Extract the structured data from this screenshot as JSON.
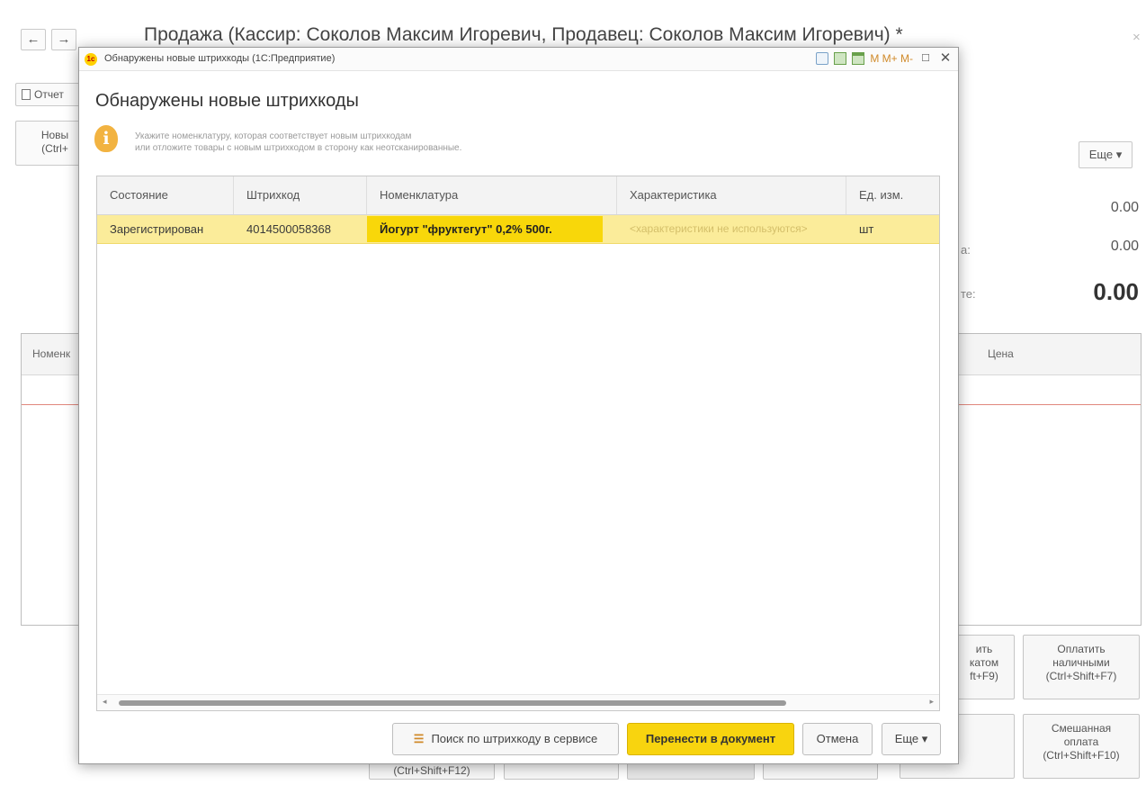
{
  "background": {
    "title": "Продажа (Кассир: Соколов Максим Игоревич, Продавец: Соколов Максим Игоревич) *",
    "back_icon": "arrow-left-icon",
    "forward_icon": "arrow-right-icon",
    "report_button": "Отчет",
    "new_button_line1": "Новы",
    "new_button_line2": "(Ctrl+",
    "more_button": "Еще ▾",
    "amount1": "0.00",
    "amount2": "0.00",
    "amount_total": "0.00",
    "label_partial1": "а:",
    "label_partial2": "те:",
    "table": {
      "col_nomenclature": "Номенк",
      "col_price": "Цена"
    },
    "buttons": {
      "pay_card_line1": "ить",
      "pay_card_line2": "катом",
      "pay_card_line3": "ft+F9)",
      "pay_cash_line1": "Оплатить",
      "pay_cash_line2": "наличными",
      "pay_cash_line3": "(Ctrl+Shift+F7)",
      "mixed_line1": "Смешанная",
      "mixed_line2": "оплата",
      "mixed_line3": "(Ctrl+Shift+F10)",
      "partial_f12": "(Ctrl+Shift+F12)"
    }
  },
  "dialog": {
    "window_title": "Обнаружены новые штрихкоды  (1С:Предприятие)",
    "heading": "Обнаружены новые штрихкоды",
    "info_line1": "Укажите номенклатуру, которая соответствует новым штрихкодам",
    "info_line2": "или отложите товары с новым штрихкодом в сторону как неотсканированные.",
    "titlebar_memory": "M  M+  M-",
    "columns": [
      "Состояние",
      "Штрихкод",
      "Номенклатура",
      "Характеристика",
      "Ед. изм."
    ],
    "rows": [
      {
        "state": "Зарегистрирован",
        "barcode": "4014500058368",
        "nomenclature": "Йогурт \"фруктегут\" 0,2% 500г.",
        "characteristic": "<характеристики не используются>",
        "unit": "шт"
      }
    ],
    "buttons": {
      "search_service": "Поиск по штрихкоду в сервисе",
      "transfer": "Перенести в документ",
      "cancel": "Отмена",
      "more": "Еще ▾"
    }
  }
}
